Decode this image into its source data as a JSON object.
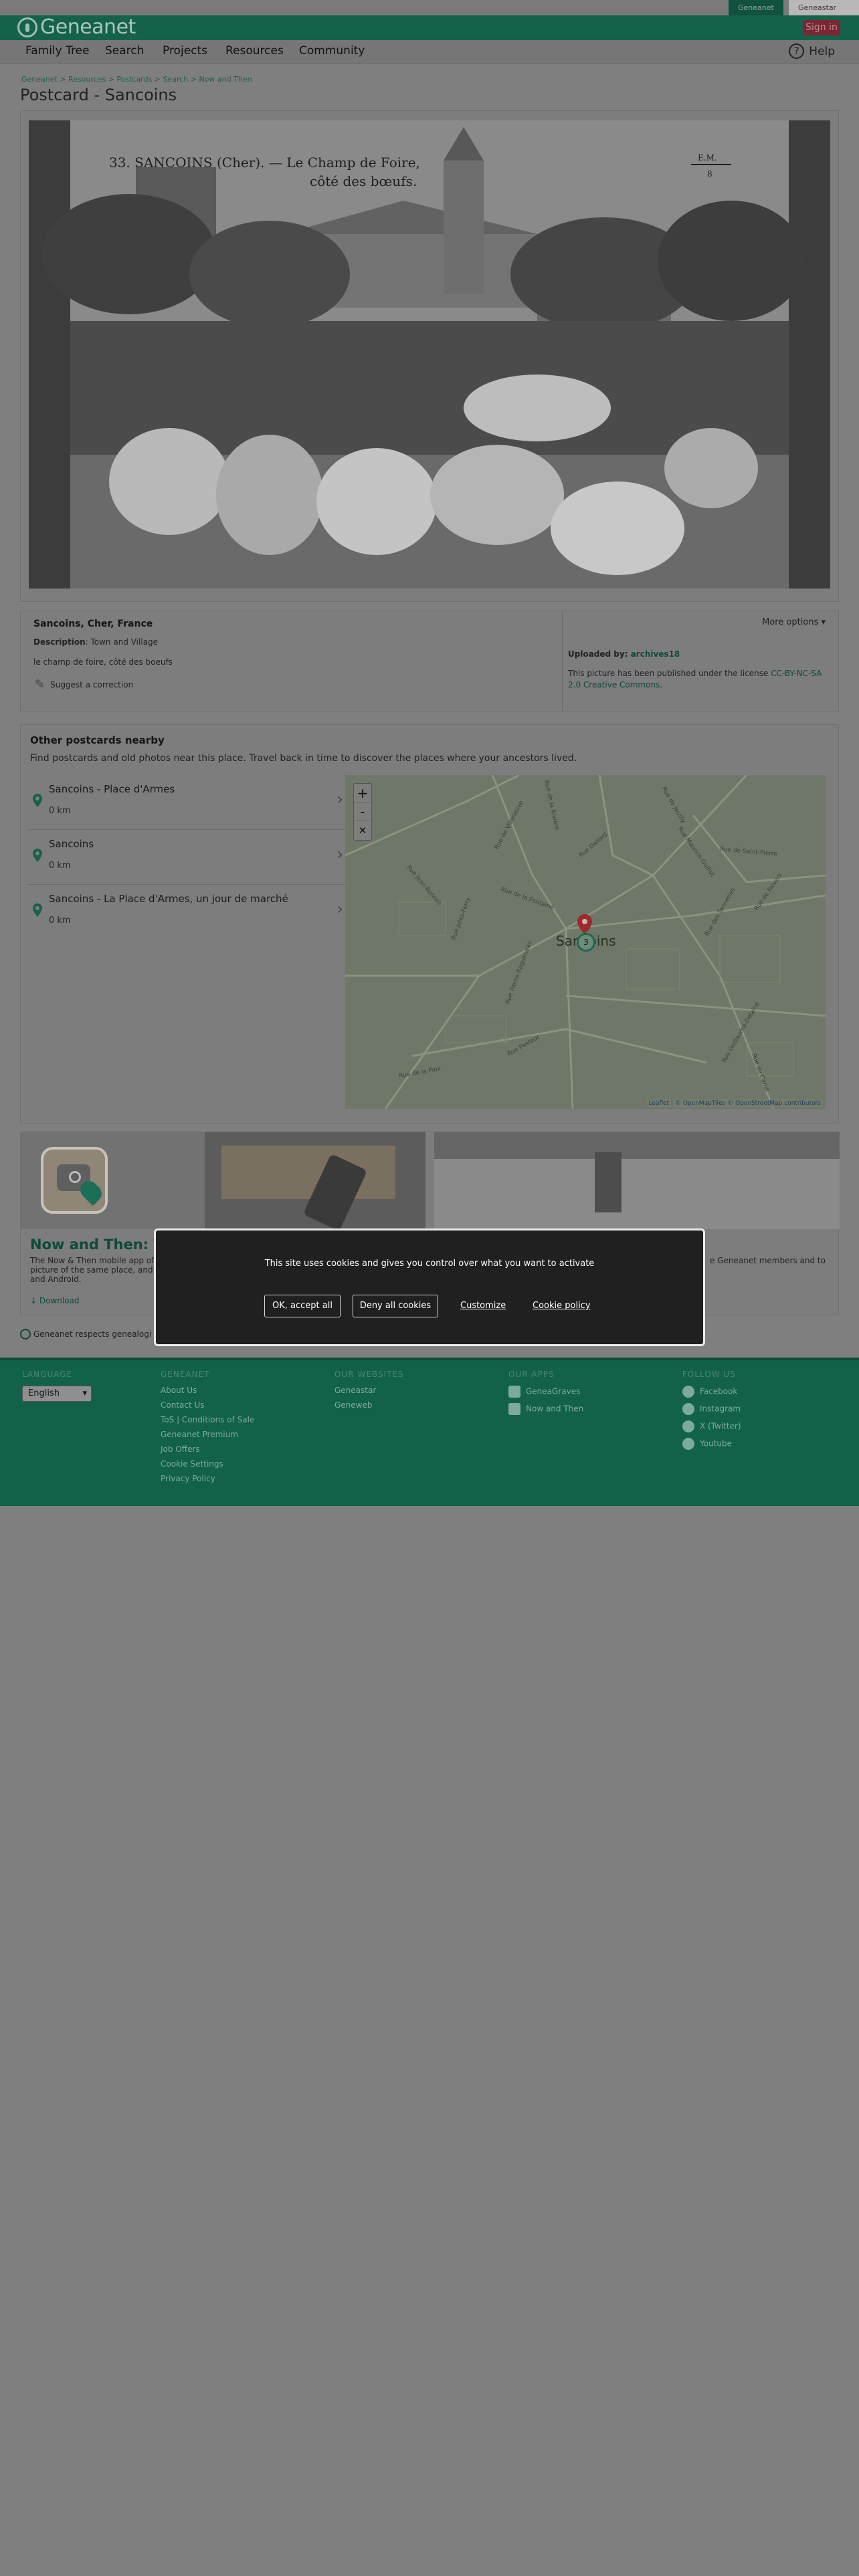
{
  "topbar": {
    "tab_geneanet": "Geneanet",
    "tab_geneastar": "Geneastar"
  },
  "header": {
    "logo_text": "Geneanet",
    "signin_label": "Sign in"
  },
  "nav": {
    "items": [
      "Family Tree",
      "Search",
      "Projects",
      "Resources",
      "Community"
    ],
    "help_label": "Help",
    "help_glyph": "?"
  },
  "breadcrumb": "Geneanet > Resources > Postcards > Search > Now and Then",
  "page_title": "Postcard - Sancoins",
  "postcard": {
    "caption_line1": "33. SANCOINS (Cher). — Le Champ de Foire,",
    "caption_line2": "côté des bœufs.",
    "corner_mark": "E.M.",
    "corner_mark2": "8",
    "location": "Sancoins, Cher, France",
    "description_label": "Description",
    "description_value": ": Town and Village",
    "subtitle": "le champ de foire, côté des boeufs",
    "suggest_label": "Suggest a correction",
    "more_options": "More options",
    "uploaded_by_label": "Uploaded by",
    "uploaded_by_user": "archives18",
    "license_text": "This picture has been published under the license",
    "license_link": "CC-BY-NC-SA 2.0 Creative Commons."
  },
  "nearby": {
    "title": "Other postcards nearby",
    "intro": "Find postcards and old photos near this place. Travel back in time to discover the places where your ancestors lived.",
    "items": [
      {
        "title": "Sancoins - Place d'Armes",
        "distance": "0 km"
      },
      {
        "title": "Sancoins",
        "distance": "0 km"
      },
      {
        "title": "Sancoins - La Place d'Armes, un jour de marché",
        "distance": "0 km"
      }
    ],
    "map": {
      "city_label": "Sancoins",
      "cluster_count": "3",
      "zoom_in": "+",
      "zoom_out": "-",
      "fullscreen": "✕",
      "attribution_leaflet": "Leaflet",
      "attribution_rest": " | © OpenMapTiles © OpenStreetMap contributors",
      "streets": [
        "Rue de Villeneuve",
        "Rue de la Rivière",
        "Rue Dallard",
        "Rue de Jeuilly",
        "Rue Maurice-Guillot",
        "Rue de la Fontaine",
        "Rue Pierre-Ragueneau",
        "Rue de Saint-Pierre",
        "Rue des Tanneries",
        "Rue de Nevers",
        "Rue Jean-Bonnet",
        "Rue Jules-Ferry",
        "Rue Guillaume-Delaine",
        "Rue Pasteur",
        "Rue de la Paix",
        "Rue du Canal"
      ]
    }
  },
  "promo": {
    "title": "Now and Then: The",
    "text": "The Now & Then mobile app of",
    "text2": "picture of the same place, and",
    "text3": "and Android.",
    "right_text": "e Geneanet members and to",
    "download": "Download"
  },
  "privacy_note": "Geneanet respects genealogi",
  "footer": {
    "language_head": "LANGUAGE",
    "language_value": "English",
    "geneanet_head": "GENEANET",
    "geneanet_links": [
      "About Us",
      "Contact Us",
      "ToS | Conditions of Sale",
      "Geneanet Premium",
      "Job Offers",
      "Cookie Settings",
      "Privacy Policy"
    ],
    "websites_head": "OUR WEBSITES",
    "websites_links": [
      "Geneastar",
      "Geneweb"
    ],
    "apps_head": "OUR APPS",
    "apps_links": [
      "GeneaGraves",
      "Now and Then"
    ],
    "follow_head": "FOLLOW US",
    "follow_links": [
      "Facebook",
      "Instagram",
      "X (Twitter)",
      "Youtube"
    ]
  },
  "cookie": {
    "message": "This site uses cookies and gives you control over what you want to activate",
    "accept": "OK, accept all",
    "deny": "Deny all cookies",
    "customize": "Customize",
    "policy": "Cookie policy"
  },
  "colors": {
    "brand_green": "#14624c",
    "signin_red": "#7b2630",
    "map_pin": "#9b2a28"
  }
}
